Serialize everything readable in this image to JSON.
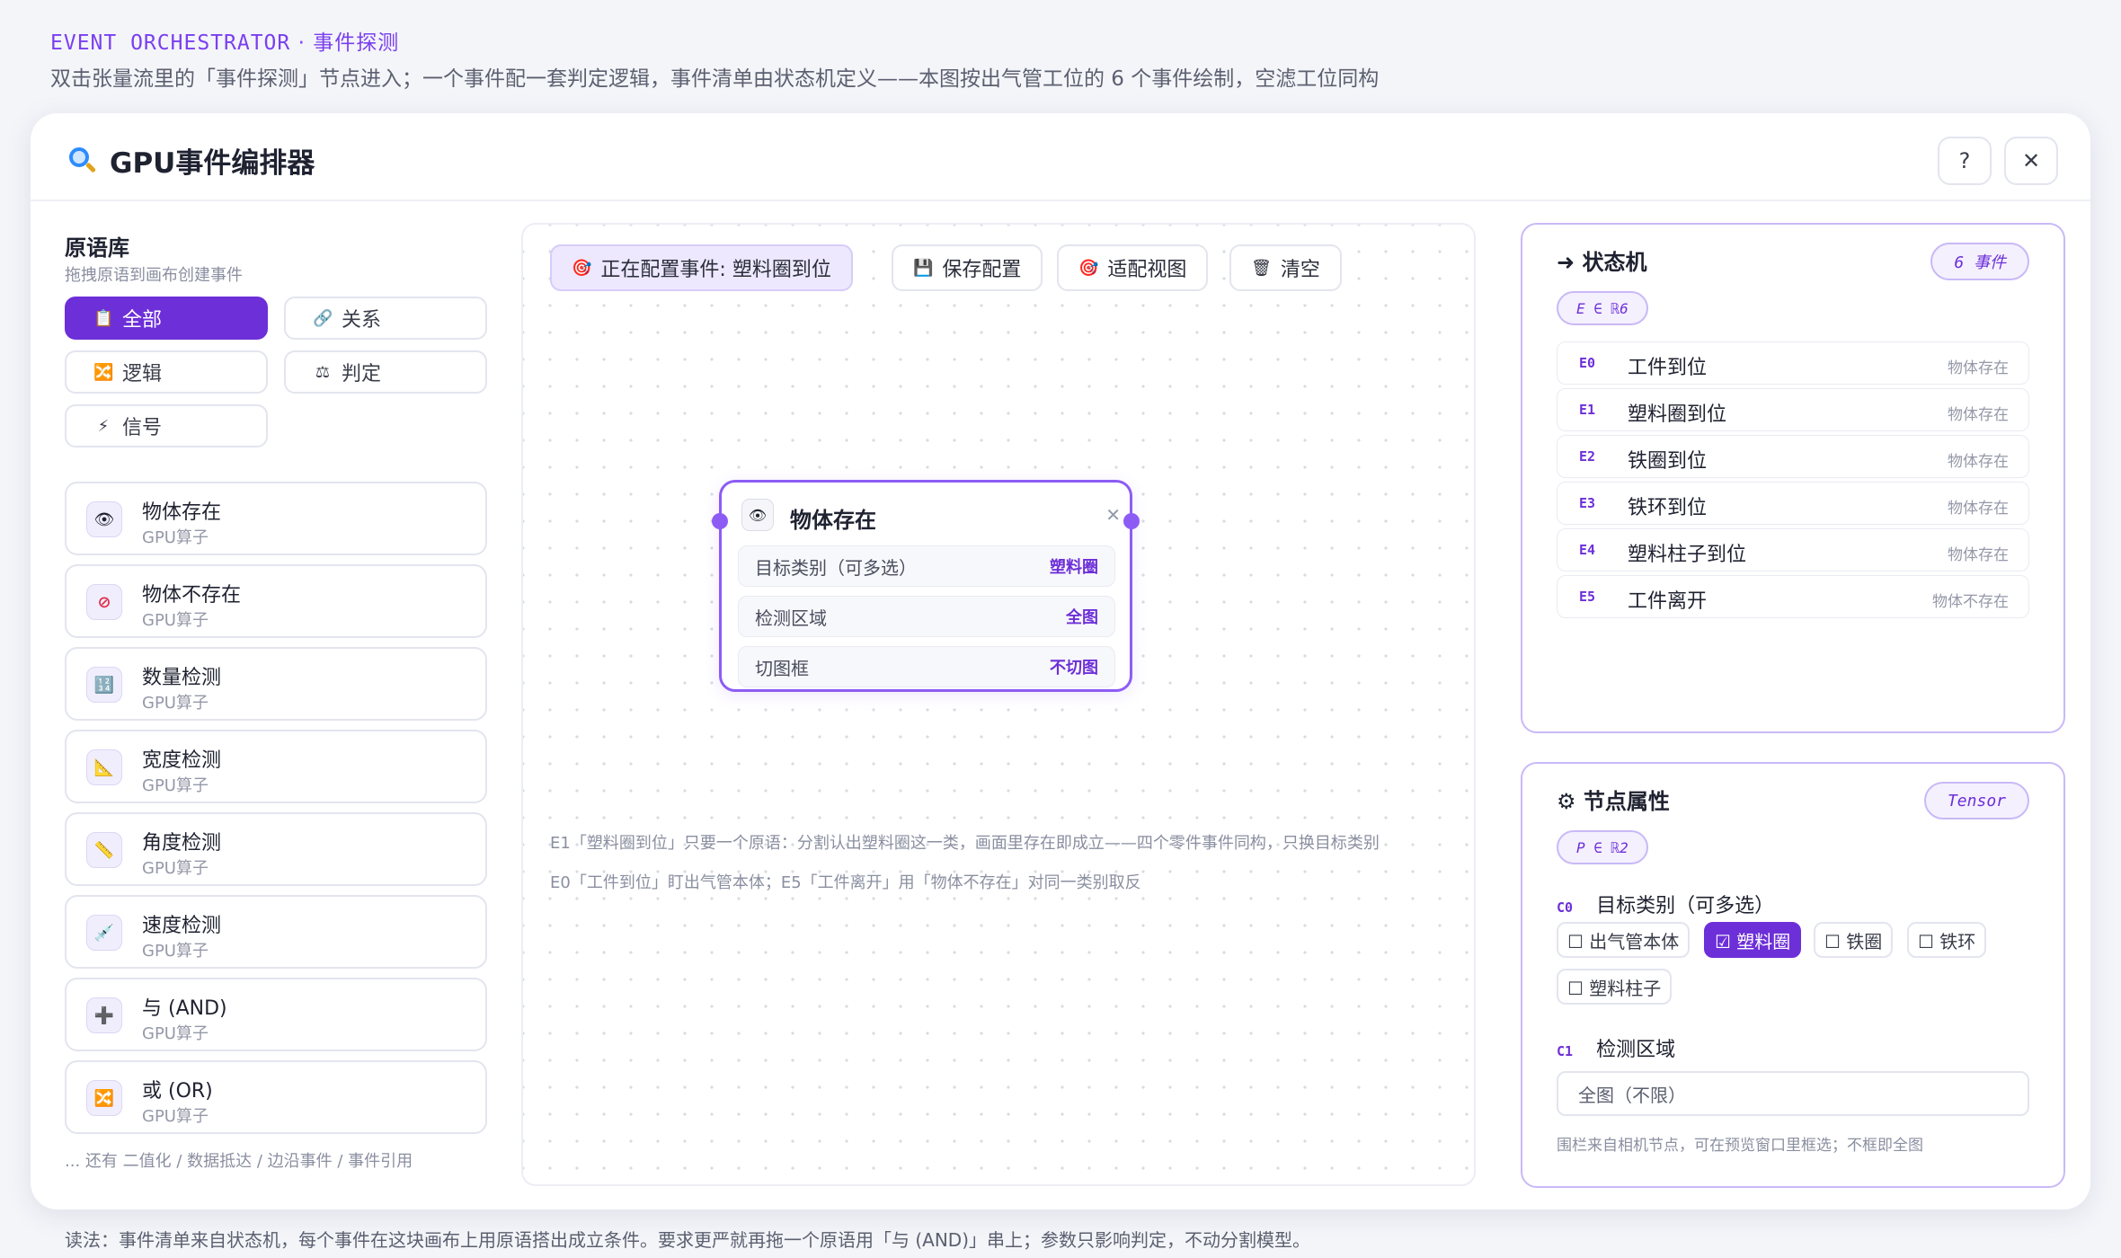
{
  "page": {
    "eyebrow_en": "EVENT ORCHESTRATOR",
    "eyebrow_sep": "·",
    "eyebrow_cn": "事件探测",
    "subtitle": "双击张量流里的「事件探测」节点进入；一个事件配一套判定逻辑，事件清单由状态机定义——本图按出气管工位的 6 个事件绘制，空滤工位同构",
    "footer": "读法：事件清单来自状态机，每个事件在这块画布上用原语搭出成立条件。要求更严就再拖一个原语用「与 (AND)」串上；参数只影响判定，不动分割模型。"
  },
  "window": {
    "title": "GPU事件编排器",
    "help_label": "?",
    "close_label": "✕"
  },
  "library": {
    "title": "原语库",
    "subtitle": "拖拽原语到画布创建事件",
    "filters": [
      {
        "icon": "📋",
        "label": "全部"
      },
      {
        "icon": "🔗",
        "label": "关系"
      },
      {
        "icon": "🔀",
        "label": "逻辑"
      },
      {
        "icon": "⚖",
        "label": "判定"
      },
      {
        "icon": "⚡",
        "label": "信号"
      }
    ],
    "items": [
      {
        "icon": "👁",
        "name": "物体存在",
        "kind": "GPU算子"
      },
      {
        "icon": "⊘",
        "name": "物体不存在",
        "kind": "GPU算子"
      },
      {
        "icon": "🔢",
        "name": "数量检测",
        "kind": "GPU算子"
      },
      {
        "icon": "📐",
        "name": "宽度检测",
        "kind": "GPU算子"
      },
      {
        "icon": "📏",
        "name": "角度检测",
        "kind": "GPU算子"
      },
      {
        "icon": "💉",
        "name": "速度检测",
        "kind": "GPU算子"
      },
      {
        "icon": "➕",
        "name": "与 (AND)",
        "kind": "GPU算子"
      },
      {
        "icon": "🔀",
        "name": "或 (OR)",
        "kind": "GPU算子"
      }
    ],
    "more": "... 还有 二值化 / 数据抵达 / 边沿事件 / 事件引用"
  },
  "canvas": {
    "toolbar": {
      "config_icon": "🎯",
      "config_label": "正在配置事件: 塑料圈到位",
      "save_icon": "💾",
      "save_label": "保存配置",
      "fit_icon": "🎯",
      "fit_label": "适配视图",
      "clear_icon": "🗑",
      "clear_label": "清空"
    },
    "node": {
      "icon": "👁",
      "title": "物体存在",
      "close": "✕",
      "rows": [
        {
          "label": "目标类别（可多选）",
          "value": "塑料圈"
        },
        {
          "label": "检测区域",
          "value": "全图"
        },
        {
          "label": "切图框",
          "value": "不切图"
        }
      ]
    },
    "notes": [
      "E1「塑料圈到位」只要一个原语：分割认出塑料圈这一类，画面里存在即成立——四个零件事件同构，只换目标类别",
      "E0「工件到位」盯出气管本体；E5「工件离开」用「物体不存在」对同一类别取反"
    ]
  },
  "state_machine": {
    "title": "➜ 状态机",
    "count_pill": "6 事件",
    "set_label": "E ∈ ℝ6",
    "events": [
      {
        "id": "E0",
        "name": "工件到位",
        "primitive": "物体存在"
      },
      {
        "id": "E1",
        "name": "塑料圈到位",
        "primitive": "物体存在"
      },
      {
        "id": "E2",
        "name": "铁圈到位",
        "primitive": "物体存在"
      },
      {
        "id": "E3",
        "name": "铁环到位",
        "primitive": "物体存在"
      },
      {
        "id": "E4",
        "name": "塑料柱子到位",
        "primitive": "物体存在"
      },
      {
        "id": "E5",
        "name": "工件离开",
        "primitive": "物体不存在"
      }
    ]
  },
  "node_props": {
    "title": "⚙ 节点属性",
    "type_pill": "Tensor",
    "set_label": "P ∈ ℝ2",
    "c0": {
      "id": "C0",
      "label": "目标类别（可多选）"
    },
    "classes": [
      {
        "label": "☐ 出气管本体",
        "checked": false
      },
      {
        "label": "☑ 塑料圈",
        "checked": true
      },
      {
        "label": "☐ 铁圈",
        "checked": false
      },
      {
        "label": "☐ 铁环",
        "checked": false
      },
      {
        "label": "☐ 塑料柱子",
        "checked": false
      }
    ],
    "c1": {
      "id": "C1",
      "label": "检测区域"
    },
    "region_value": "全图（不限）",
    "hint": "围栏来自相机节点，可在预览窗口里框选；不框即全图"
  },
  "colors": {
    "accent": "#6d2fd8",
    "accent_light": "#8d5cf5",
    "panel_border": "#c9b9f7"
  }
}
